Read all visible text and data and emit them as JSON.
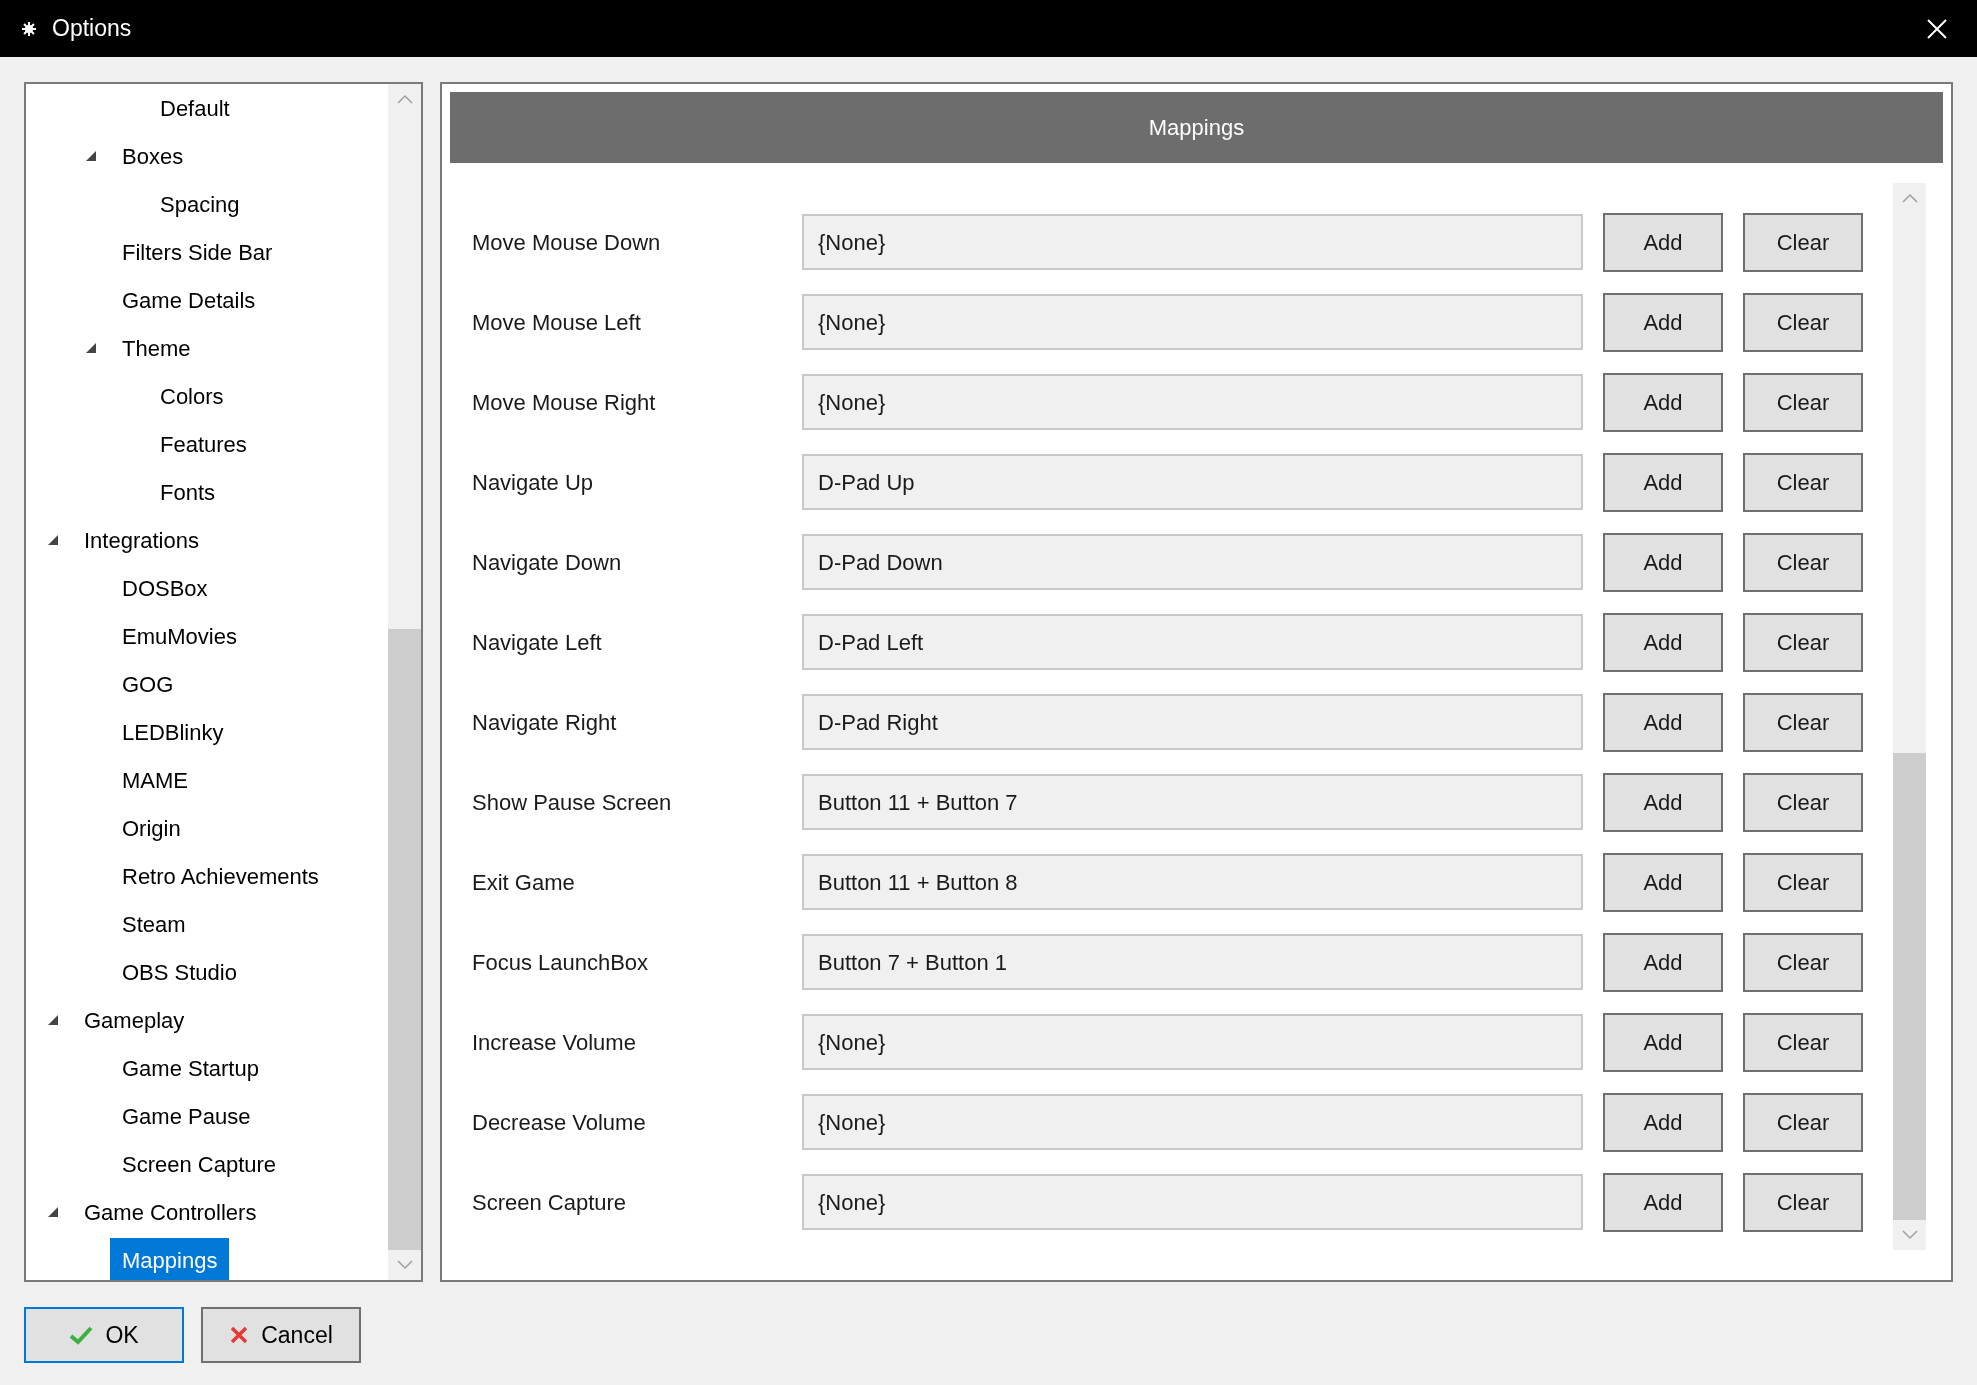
{
  "window": {
    "title": "Options"
  },
  "tree": {
    "items": [
      {
        "children": [
          {
            "children": [
              {
                "label": "Default",
                "selected": false
              }
            ]
          },
          {
            "label": "Boxes",
            "expanded": true,
            "selected": false,
            "children": [
              {
                "label": "Spacing",
                "selected": false
              }
            ]
          },
          {
            "label": "Filters Side Bar",
            "selected": false
          },
          {
            "label": "Game Details",
            "selected": false
          },
          {
            "label": "Theme",
            "expanded": true,
            "selected": false,
            "children": [
              {
                "label": "Colors",
                "selected": false
              },
              {
                "label": "Features",
                "selected": false
              },
              {
                "label": "Fonts",
                "selected": false
              }
            ]
          }
        ]
      },
      {
        "label": "Integrations",
        "expanded": true,
        "selected": false,
        "children": [
          {
            "label": "DOSBox",
            "selected": false
          },
          {
            "label": "EmuMovies",
            "selected": false
          },
          {
            "label": "GOG",
            "selected": false
          },
          {
            "label": "LEDBlinky",
            "selected": false
          },
          {
            "label": "MAME",
            "selected": false
          },
          {
            "label": "Origin",
            "selected": false
          },
          {
            "label": "Retro Achievements",
            "selected": false
          },
          {
            "label": "Steam",
            "selected": false
          },
          {
            "label": "OBS Studio",
            "selected": false
          }
        ]
      },
      {
        "label": "Gameplay",
        "expanded": true,
        "selected": false,
        "children": [
          {
            "label": "Game Startup",
            "selected": false
          },
          {
            "label": "Game Pause",
            "selected": false
          },
          {
            "label": "Screen Capture",
            "selected": false
          }
        ]
      },
      {
        "label": "Game Controllers",
        "expanded": true,
        "selected": false,
        "children": [
          {
            "label": "Mappings",
            "selected": true
          }
        ]
      }
    ]
  },
  "panel": {
    "title": "Mappings",
    "mappings": [
      {
        "action": "Move Mouse Down",
        "value": "{None}",
        "add": "Add",
        "clear": "Clear"
      },
      {
        "action": "Move Mouse Left",
        "value": "{None}",
        "add": "Add",
        "clear": "Clear"
      },
      {
        "action": "Move Mouse Right",
        "value": "{None}",
        "add": "Add",
        "clear": "Clear"
      },
      {
        "action": "Navigate Up",
        "value": "D-Pad Up",
        "add": "Add",
        "clear": "Clear"
      },
      {
        "action": "Navigate Down",
        "value": "D-Pad Down",
        "add": "Add",
        "clear": "Clear"
      },
      {
        "action": "Navigate Left",
        "value": "D-Pad Left",
        "add": "Add",
        "clear": "Clear"
      },
      {
        "action": "Navigate Right",
        "value": "D-Pad Right",
        "add": "Add",
        "clear": "Clear"
      },
      {
        "action": "Show Pause Screen",
        "value": "Button 11 + Button 7",
        "add": "Add",
        "clear": "Clear"
      },
      {
        "action": "Exit Game",
        "value": "Button 11 + Button 8",
        "add": "Add",
        "clear": "Clear"
      },
      {
        "action": "Focus LaunchBox",
        "value": "Button 7 + Button 1",
        "add": "Add",
        "clear": "Clear"
      },
      {
        "action": "Increase Volume",
        "value": "{None}",
        "add": "Add",
        "clear": "Clear"
      },
      {
        "action": "Decrease Volume",
        "value": "{None}",
        "add": "Add",
        "clear": "Clear"
      },
      {
        "action": "Screen Capture",
        "value": "{None}",
        "add": "Add",
        "clear": "Clear"
      }
    ]
  },
  "buttons": {
    "ok": "OK",
    "cancel": "Cancel"
  }
}
